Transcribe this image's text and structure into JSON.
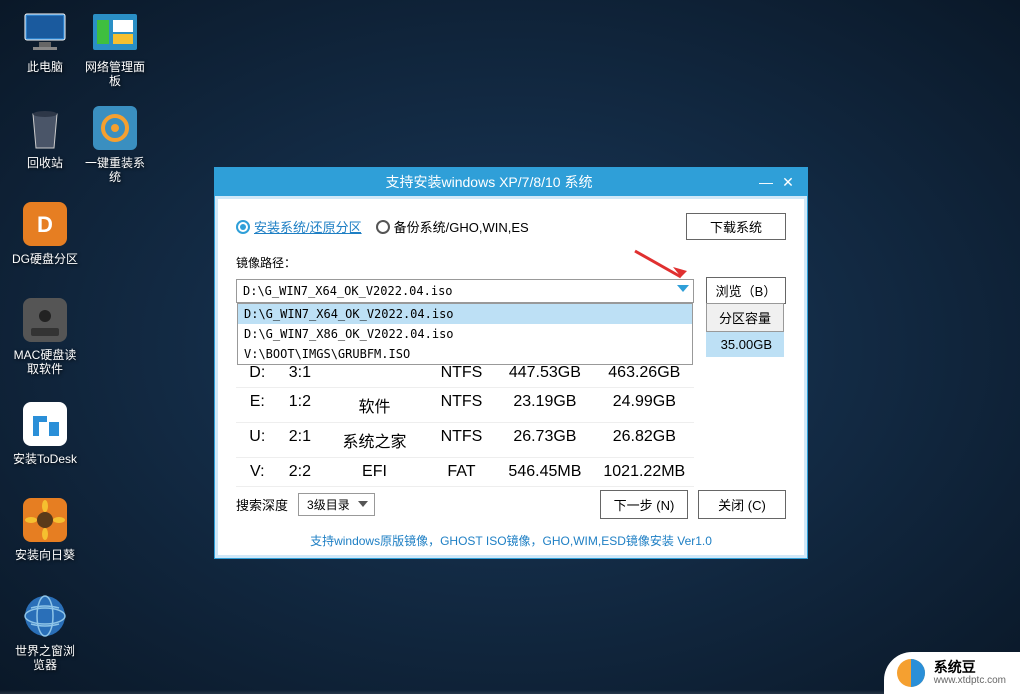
{
  "desktop": {
    "icons": [
      {
        "label": "此电脑"
      },
      {
        "label": "网络管理面板"
      },
      {
        "label": "回收站"
      },
      {
        "label": "一键重装系统"
      },
      {
        "label": "DG硬盘分区"
      },
      {
        "label": "MAC硬盘读取软件"
      },
      {
        "label": "安装ToDesk"
      },
      {
        "label": "安装向日葵"
      },
      {
        "label": "世界之窗浏览器"
      }
    ]
  },
  "window": {
    "title": "支持安装windows XP/7/8/10 系统",
    "radio1": "安装系统/还原分区",
    "radio2": "备份系统/GHO,WIN,ES",
    "btn_download": "下载系统",
    "label_path": "镜像路径：",
    "combo_value": "D:\\G_WIN7_X64_OK_V2022.04.iso",
    "dropdown_options": [
      "D:\\G_WIN7_X64_OK_V2022.04.iso",
      "D:\\G_WIN7_X86_OK_V2022.04.iso",
      "V:\\BOOT\\IMGS\\GRUBFM.ISO"
    ],
    "btn_browse": "浏览（B）",
    "table": {
      "head_partial": "分区容量",
      "row_partial": "35.00GB",
      "rows": [
        {
          "drive": "D:",
          "ratio": "3:1",
          "name": "",
          "fs": "NTFS",
          "used": "447.53GB",
          "total": "463.26GB"
        },
        {
          "drive": "E:",
          "ratio": "1:2",
          "name": "软件",
          "fs": "NTFS",
          "used": "23.19GB",
          "total": "24.99GB"
        },
        {
          "drive": "U:",
          "ratio": "2:1",
          "name": "系统之家",
          "fs": "NTFS",
          "used": "26.73GB",
          "total": "26.82GB"
        },
        {
          "drive": "V:",
          "ratio": "2:2",
          "name": "EFI",
          "fs": "FAT",
          "used": "546.45MB",
          "total": "1021.22MB"
        }
      ]
    },
    "label_depth": "搜索深度",
    "depth_value": "3级目录",
    "btn_next": "下一步 (N)",
    "btn_close": "关闭 (C)",
    "footer": "支持windows原版镜像，GHOST ISO镜像，GHO,WIM,ESD镜像安装 Ver1.0"
  },
  "watermark": {
    "name": "系统豆",
    "url": "www.xtdptc.com"
  }
}
